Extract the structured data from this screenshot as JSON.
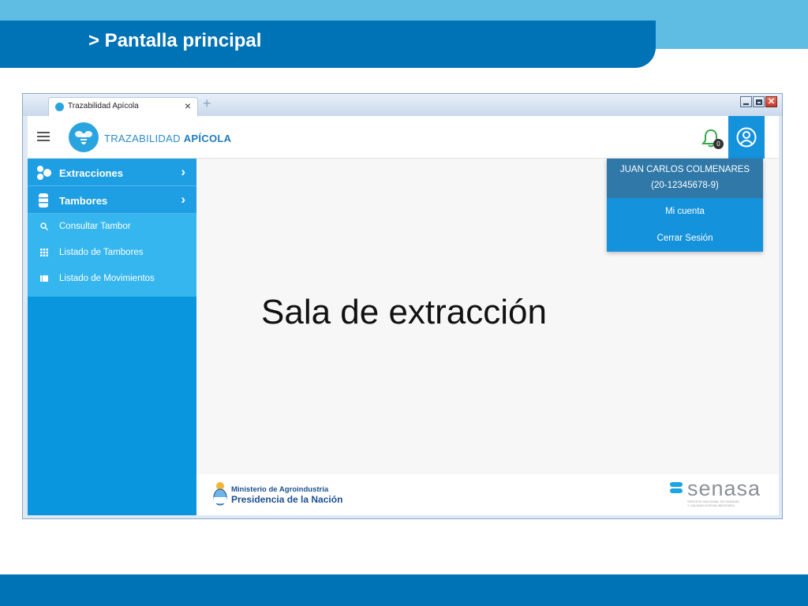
{
  "slide": {
    "title": "> Pantalla principal"
  },
  "browser": {
    "tab_title": "Trazabilidad Apícola",
    "tab_close": "×",
    "new_tab": "+"
  },
  "app": {
    "brand_prefix": "TRAZABILIDAD ",
    "brand_bold": "APÍCOLA",
    "notifications_count": "0"
  },
  "sidebar": {
    "items": [
      {
        "label": "Extracciones",
        "icon": "honeycomb-icon"
      },
      {
        "label": "Tambores",
        "icon": "barrel-icon"
      }
    ],
    "subitems": [
      {
        "label": "Consultar Tambor",
        "icon": "search-icon"
      },
      {
        "label": "Listado de Tambores",
        "icon": "grid-icon"
      },
      {
        "label": "Listado de Movimientos",
        "icon": "list-icon"
      }
    ]
  },
  "main": {
    "title": "Sala de extracción"
  },
  "user_menu": {
    "name": "JUAN CARLOS COLMENARES",
    "id": "(20-12345678-9)",
    "account": "Mi cuenta",
    "logout": "Cerrar Sesión"
  },
  "footer": {
    "ministry_line1": "Ministerio de Agroindustria",
    "ministry_line2": "Presidencia de la Nación",
    "senasa_word": "senasa",
    "senasa_sub_line1": "SERVICIO NACIONAL DE SANIDAD",
    "senasa_sub_line2": "Y CALIDAD AGROALIMENTARIA"
  },
  "colors": {
    "slide_dark_blue": "#0072b6",
    "slide_light_blue": "#5fbce2",
    "sidebar_blue": "#0a96de",
    "submenu_blue": "#35b6ef",
    "user_menu_head": "#2f78a8"
  }
}
